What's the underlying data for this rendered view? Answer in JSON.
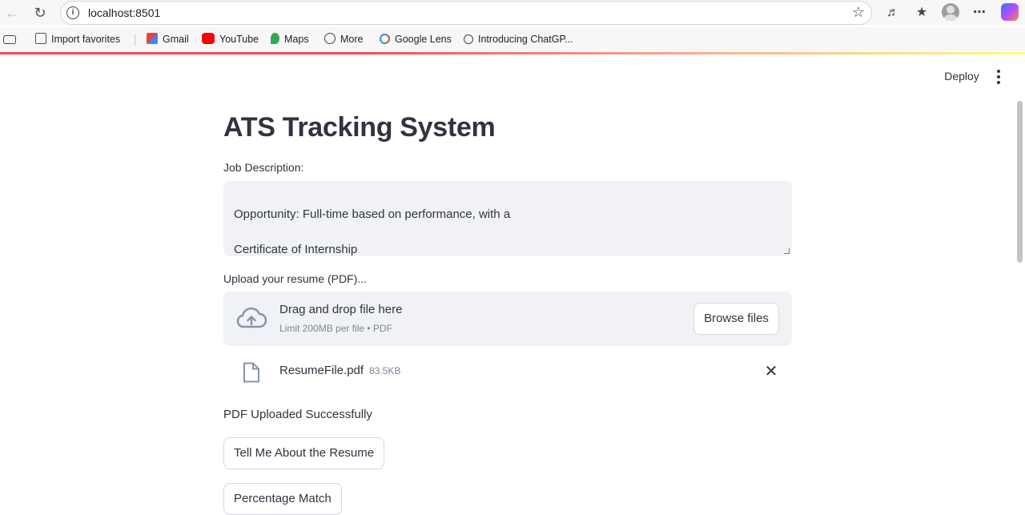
{
  "browser": {
    "url": "localhost:8501",
    "bookmarks": [
      {
        "label": "Import favorites",
        "icon": "import-favorites-icon"
      },
      {
        "label": "Gmail",
        "icon": "gmail-icon"
      },
      {
        "label": "YouTube",
        "icon": "youtube-icon"
      },
      {
        "label": "Maps",
        "icon": "maps-icon"
      },
      {
        "label": "More",
        "icon": "globe-icon"
      },
      {
        "label": "Google Lens",
        "icon": "google-icon"
      },
      {
        "label": "Introducing ChatGP...",
        "icon": "chatgpt-icon"
      }
    ],
    "accent_colors": {
      "loading_bar": "#ff4b4b",
      "text": "#31333f",
      "muted": "#808495",
      "input_bg": "#f0f2f6"
    }
  },
  "header": {
    "deploy_label": "Deploy"
  },
  "main": {
    "title": "ATS Tracking System",
    "job_description": {
      "label": "Job Description:",
      "value": "Opportunity: Full-time based on performance, with a\n\nCertificate of Internship"
    },
    "upload": {
      "label": "Upload your resume (PDF)...",
      "drop_title": "Drag and drop file here",
      "drop_subtitle": "Limit 200MB per file • PDF",
      "browse_label": "Browse files",
      "file": {
        "name": "ResumeFile.pdf",
        "size": "83.5KB"
      }
    },
    "status_text": "PDF Uploaded Successfully",
    "buttons": {
      "tell_me": "Tell Me About the Resume",
      "percentage_match": "Percentage Match"
    }
  }
}
